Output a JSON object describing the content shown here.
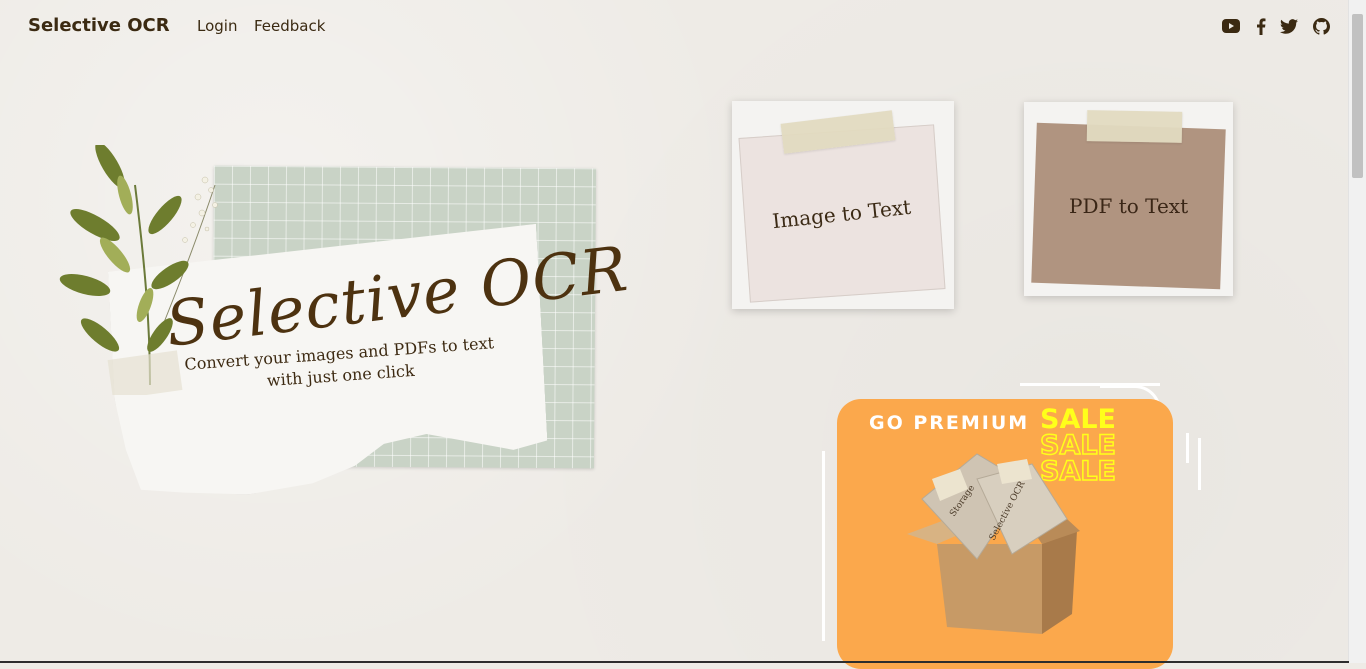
{
  "nav": {
    "brand": "Selective OCR",
    "links": [
      "Login",
      "Feedback"
    ],
    "social_icons": [
      "youtube-icon",
      "facebook-icon",
      "twitter-icon",
      "github-icon"
    ]
  },
  "hero": {
    "title": "Selective OCR",
    "subtitle": "Convert your images and PDFs to text with just one click"
  },
  "cards": [
    {
      "label": "Image to Text",
      "color": "#ece3e0"
    },
    {
      "label": "PDF to Text",
      "color": "#b09480"
    }
  ],
  "promo": {
    "headline": "GO PREMIUM",
    "sale_word": "SALE",
    "box_labels": [
      "Storage",
      "Selective OCR"
    ],
    "background": "#fba84c",
    "accent": "#ffff1a"
  },
  "colors": {
    "page_background": "#eeebe6",
    "text_brown": "#3b2a12",
    "grid_paper": "#c9d3c6"
  }
}
